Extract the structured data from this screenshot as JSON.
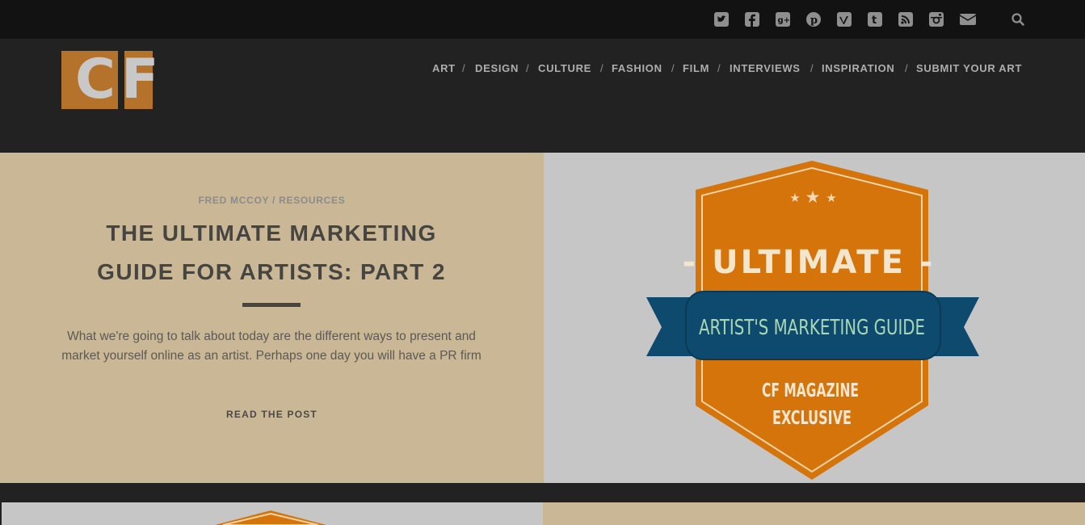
{
  "social_icons": [
    {
      "name": "twitter-icon",
      "glyph": "t"
    },
    {
      "name": "facebook-icon",
      "glyph": "f"
    },
    {
      "name": "google-plus-icon",
      "glyph": "g+"
    },
    {
      "name": "pinterest-icon",
      "glyph": "p"
    },
    {
      "name": "vimeo-icon",
      "glyph": "v"
    },
    {
      "name": "tumblr-icon",
      "glyph": "t"
    },
    {
      "name": "rss-icon",
      "glyph": "rss"
    },
    {
      "name": "instagram-icon",
      "glyph": "ig"
    },
    {
      "name": "mail-icon",
      "glyph": "mail"
    }
  ],
  "search_icon": "search-icon",
  "logo": {
    "letters": [
      "C",
      "F"
    ],
    "accent": "#b5722a"
  },
  "nav": {
    "items": [
      "ART",
      "DESIGN",
      "CULTURE",
      "FASHION",
      "FILM",
      "INTERVIEWS",
      "INSPIRATION",
      "SUBMIT YOUR ART"
    ],
    "separator": "/"
  },
  "hero": {
    "author": "FRED MCCOY",
    "separator": "/",
    "category": "RESOURCES",
    "title": "THE ULTIMATE MARKETING GUIDE FOR ARTISTS: PART 2",
    "excerpt": "What we're going to talk about today are the different ways to present and market yourself online as an artist. Perhaps one day you will have a PR firm",
    "read_more": "READ THE POST",
    "background": "#c9b796"
  },
  "badge": {
    "heading": "- ULTIMATE -",
    "ribbon": "ARTIST'S MARKETING GUIDE",
    "line1": "CF MAGAZINE",
    "line2": "EXCLUSIVE",
    "orange": "#d4740a",
    "ribbon_color": "#0e4a6e",
    "ribbon_text_color": "#a9d7b5"
  }
}
